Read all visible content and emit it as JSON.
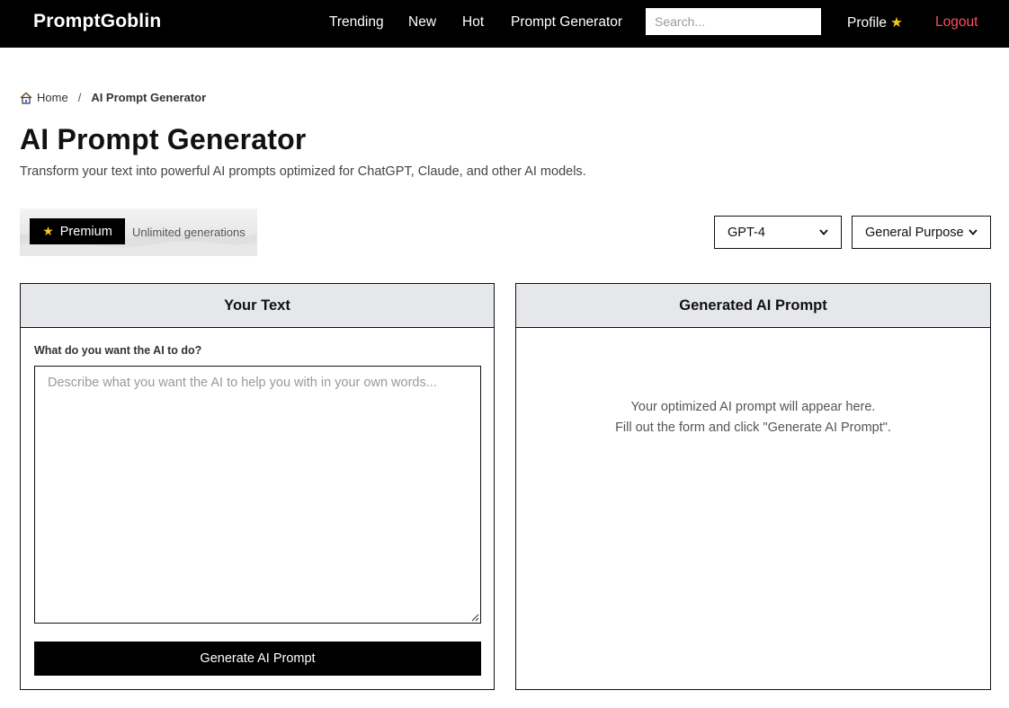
{
  "nav": {
    "brand": "PromptGoblin",
    "links": [
      "Trending",
      "New",
      "Hot",
      "Prompt Generator"
    ],
    "search_placeholder": "Search...",
    "profile": "Profile",
    "logout": "Logout",
    "star": "★"
  },
  "breadcrumb": {
    "home": "Home",
    "separator": "/",
    "current": "AI Prompt Generator"
  },
  "header": {
    "title": "AI Prompt Generator",
    "subtitle": "Transform your text into powerful AI prompts optimized for ChatGPT, Claude, and other AI models."
  },
  "premium": {
    "label": "Premium",
    "note": "Unlimited generations"
  },
  "selects": {
    "model": "GPT-4",
    "purpose": "General Purpose"
  },
  "left_panel": {
    "title": "Your Text",
    "field_label": "What do you want the AI to do?",
    "textarea_placeholder": "Describe what you want the AI to help you with in your own words...",
    "button": "Generate AI Prompt"
  },
  "right_panel": {
    "title": "Generated AI Prompt",
    "empty_line1": "Your optimized AI prompt will appear here.",
    "empty_line2": "Fill out the form and click \"Generate AI Prompt\"."
  },
  "colors": {
    "nav_bg": "#000000",
    "logout": "#ff4d5e",
    "star": "#f5c518",
    "panel_header": "#e6e7ea"
  }
}
